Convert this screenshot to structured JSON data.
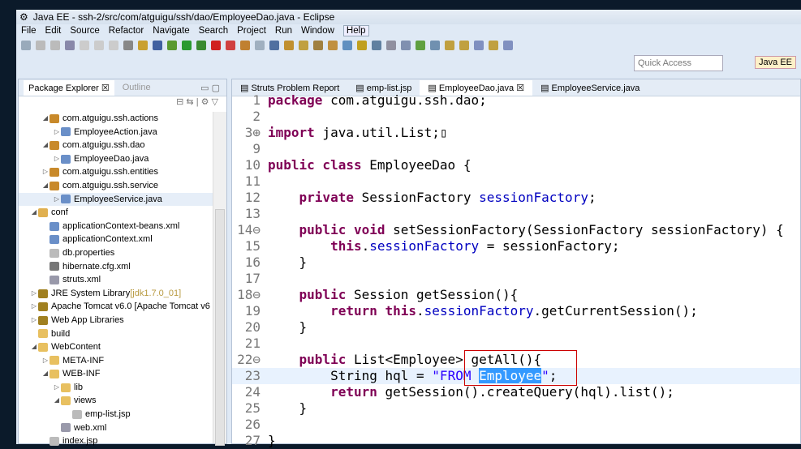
{
  "title": "Java EE - ssh-2/src/com/atguigu/ssh/dao/EmployeeDao.java - Eclipse",
  "menu": [
    "File",
    "Edit",
    "Source",
    "Refactor",
    "Navigate",
    "Search",
    "Project",
    "Run",
    "Window",
    "Help"
  ],
  "quick_access": "Quick Access",
  "perspective": "Java EE",
  "left_tabs": {
    "explorer": "Package Explorer",
    "outline": "Outline"
  },
  "tree": [
    {
      "label": "com.atguigu.ssh.actions",
      "indent": 2,
      "tw": "◢",
      "icon": "package",
      "color": "#c8892a"
    },
    {
      "label": "EmployeeAction.java",
      "indent": 3,
      "tw": "▷",
      "icon": "java-file",
      "color": "#6a8fc8"
    },
    {
      "label": "com.atguigu.ssh.dao",
      "indent": 2,
      "tw": "◢",
      "icon": "package",
      "color": "#c8892a"
    },
    {
      "label": "EmployeeDao.java",
      "indent": 3,
      "tw": "▷",
      "icon": "java-file",
      "color": "#6a8fc8"
    },
    {
      "label": "com.atguigu.ssh.entities",
      "indent": 2,
      "tw": "▷",
      "icon": "package",
      "color": "#c8892a"
    },
    {
      "label": "com.atguigu.ssh.service",
      "indent": 2,
      "tw": "◢",
      "icon": "package",
      "color": "#c8892a"
    },
    {
      "label": "EmployeeService.java",
      "indent": 3,
      "tw": "▷",
      "icon": "java-file",
      "color": "#6a8fc8",
      "selected": true
    },
    {
      "label": "conf",
      "indent": 1,
      "tw": "◢",
      "icon": "source-folder",
      "color": "#e0b050"
    },
    {
      "label": "applicationContext-beans.xml",
      "indent": 2,
      "tw": "",
      "icon": "spring-xml",
      "color": "#6a8fc8"
    },
    {
      "label": "applicationContext.xml",
      "indent": 2,
      "tw": "",
      "icon": "spring-xml",
      "color": "#6a8fc8"
    },
    {
      "label": "db.properties",
      "indent": 2,
      "tw": "",
      "icon": "file",
      "color": "#bbb"
    },
    {
      "label": "hibernate.cfg.xml",
      "indent": 2,
      "tw": "",
      "icon": "hibernate",
      "color": "#777"
    },
    {
      "label": "struts.xml",
      "indent": 2,
      "tw": "",
      "icon": "xml-file",
      "color": "#99a"
    },
    {
      "label": "JRE System Library",
      "extra": " [jdk1.7.0_01]",
      "indent": 1,
      "tw": "▷",
      "icon": "library",
      "color": "#a08020"
    },
    {
      "label": "Apache Tomcat v6.0 [Apache Tomcat v6",
      "indent": 1,
      "tw": "▷",
      "icon": "library",
      "color": "#a08020"
    },
    {
      "label": "Web App Libraries",
      "indent": 1,
      "tw": "▷",
      "icon": "library",
      "color": "#a08020"
    },
    {
      "label": "build",
      "indent": 1,
      "tw": "",
      "icon": "folder",
      "color": "#e8c060"
    },
    {
      "label": "WebContent",
      "indent": 1,
      "tw": "◢",
      "icon": "folder",
      "color": "#e8c060"
    },
    {
      "label": "META-INF",
      "indent": 2,
      "tw": "▷",
      "icon": "folder",
      "color": "#e8c060"
    },
    {
      "label": "WEB-INF",
      "indent": 2,
      "tw": "◢",
      "icon": "folder",
      "color": "#e8c060"
    },
    {
      "label": "lib",
      "indent": 3,
      "tw": "▷",
      "icon": "folder",
      "color": "#e8c060"
    },
    {
      "label": "views",
      "indent": 3,
      "tw": "◢",
      "icon": "folder",
      "color": "#e8c060"
    },
    {
      "label": "emp-list.jsp",
      "indent": 4,
      "tw": "",
      "icon": "file",
      "color": "#bbb"
    },
    {
      "label": "web.xml",
      "indent": 3,
      "tw": "",
      "icon": "xml-file",
      "color": "#99a"
    },
    {
      "label": "index.jsp",
      "indent": 2,
      "tw": "",
      "icon": "file",
      "color": "#bbb"
    }
  ],
  "editor_tabs": [
    {
      "label": "Struts Problem Report"
    },
    {
      "label": "emp-list.jsp"
    },
    {
      "label": "EmployeeDao.java",
      "active": true
    },
    {
      "label": "EmployeeService.java"
    }
  ],
  "code": [
    {
      "n": "1",
      "html": "<span class=kw>package</span> com.atguigu.ssh.dao;"
    },
    {
      "n": "2",
      "html": ""
    },
    {
      "n": "3⊕",
      "html": "<span class=kw>import</span> java.util.List;▯"
    },
    {
      "n": "9",
      "html": ""
    },
    {
      "n": "10",
      "html": "<span class=kw>public class</span> EmployeeDao {"
    },
    {
      "n": "11",
      "html": ""
    },
    {
      "n": "12",
      "html": "    <span class=kw>private</span> SessionFactory <span class=fld>sessionFactory</span>;"
    },
    {
      "n": "13",
      "html": ""
    },
    {
      "n": "14⊖",
      "html": "    <span class=kw>public void</span> setSessionFactory(SessionFactory sessionFactory) {"
    },
    {
      "n": "15",
      "html": "        <span class=kw>this</span>.<span class=fld>sessionFactory</span> = sessionFactory;"
    },
    {
      "n": "16",
      "html": "    }"
    },
    {
      "n": "17",
      "html": ""
    },
    {
      "n": "18⊖",
      "html": "    <span class=kw>public</span> Session getSession(){"
    },
    {
      "n": "19",
      "html": "        <span class=kw>return this</span>.<span class=fld>sessionFactory</span>.getCurrentSession();"
    },
    {
      "n": "20",
      "html": "    }"
    },
    {
      "n": "21",
      "html": ""
    },
    {
      "n": "22⊖",
      "html": "    <span class=kw>public</span> List&lt;Employee&gt; getAll(){"
    },
    {
      "n": "23",
      "html": "        String hql = <span class=str>\"FROM <span class=hl>Employee</span>\"</span>;",
      "cur": true
    },
    {
      "n": "24",
      "html": "        <span class=kw>return</span> getSession().createQuery(hql).list();"
    },
    {
      "n": "25",
      "html": "    }"
    },
    {
      "n": "26",
      "html": ""
    },
    {
      "n": "27",
      "html": "}"
    }
  ]
}
